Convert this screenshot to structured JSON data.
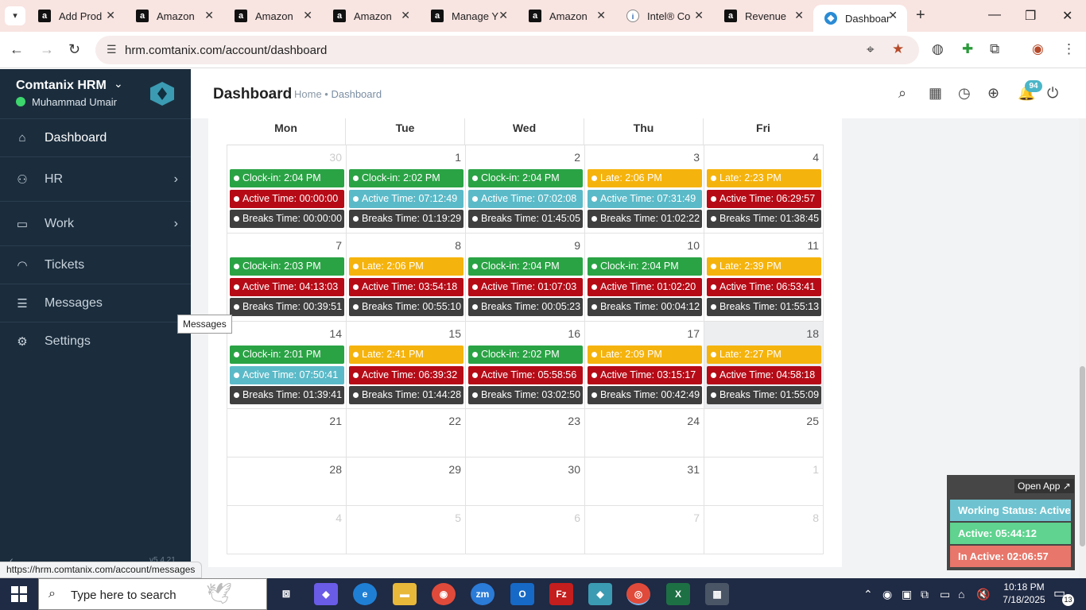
{
  "browser": {
    "tabs": [
      {
        "title": "Add Prod",
        "favicon": "amazon-a"
      },
      {
        "title": "Amazon",
        "favicon": "amazon-a"
      },
      {
        "title": "Amazon",
        "favicon": "amazon-a"
      },
      {
        "title": "Amazon",
        "favicon": "amazon-a"
      },
      {
        "title": "Manage Y",
        "favicon": "amazon-a"
      },
      {
        "title": "Amazon",
        "favicon": "amazon-a"
      },
      {
        "title": "Intel® Co",
        "favicon": "intel"
      },
      {
        "title": "Revenue",
        "favicon": "amazon-a"
      },
      {
        "title": "Dashboar",
        "favicon": "comtanix",
        "active": true
      }
    ],
    "url": "hrm.comtanix.com/account/dashboard",
    "status_url": "https://hrm.comtanix.com/account/messages"
  },
  "sidebar": {
    "brand": "Comtanix HRM",
    "user": "Muhammad Umair",
    "items": [
      {
        "label": "Dashboard",
        "icon": "home-icon",
        "active": true
      },
      {
        "label": "HR",
        "icon": "users-icon",
        "submenu": true
      },
      {
        "label": "Work",
        "icon": "briefcase-icon",
        "submenu": true
      },
      {
        "label": "Tickets",
        "icon": "headset-icon"
      },
      {
        "label": "Messages",
        "icon": "message-icon"
      },
      {
        "label": "Settings",
        "icon": "gear-icon"
      }
    ],
    "tooltip": "Messages",
    "version": "v5.4.21"
  },
  "header": {
    "title": "Dashboard",
    "breadcrumb_home": "Home",
    "breadcrumb_sep": " • ",
    "breadcrumb_current": "Dashboard",
    "notification_count": "94"
  },
  "calendar": {
    "days_of_week": [
      "Mon",
      "Tue",
      "Wed",
      "Thu",
      "Fri"
    ],
    "weeks": [
      [
        {
          "day": "30",
          "other": true,
          "events": [
            {
              "type": "green",
              "text": "Clock-in: 2:04 PM"
            },
            {
              "type": "red",
              "text": "Active Time: 00:00:00"
            },
            {
              "type": "dark",
              "text": "Breaks Time: 00:00:00"
            }
          ]
        },
        {
          "day": "1",
          "events": [
            {
              "type": "green",
              "text": "Clock-in: 2:02 PM"
            },
            {
              "type": "teal",
              "text": "Active Time: 07:12:49"
            },
            {
              "type": "dark",
              "text": "Breaks Time: 01:19:29"
            }
          ]
        },
        {
          "day": "2",
          "events": [
            {
              "type": "green",
              "text": "Clock-in: 2:04 PM"
            },
            {
              "type": "teal",
              "text": "Active Time: 07:02:08"
            },
            {
              "type": "dark",
              "text": "Breaks Time: 01:45:05"
            }
          ]
        },
        {
          "day": "3",
          "events": [
            {
              "type": "amber",
              "text": "Late: 2:06 PM"
            },
            {
              "type": "teal",
              "text": "Active Time: 07:31:49"
            },
            {
              "type": "dark",
              "text": "Breaks Time: 01:02:22"
            }
          ]
        },
        {
          "day": "4",
          "events": [
            {
              "type": "amber",
              "text": "Late: 2:23 PM"
            },
            {
              "type": "red",
              "text": "Active Time: 06:29:57"
            },
            {
              "type": "dark",
              "text": "Breaks Time: 01:38:45"
            }
          ]
        }
      ],
      [
        {
          "day": "7",
          "events": [
            {
              "type": "green",
              "text": "Clock-in: 2:03 PM"
            },
            {
              "type": "red",
              "text": "Active Time: 04:13:03"
            },
            {
              "type": "dark",
              "text": "Breaks Time: 00:39:51"
            }
          ]
        },
        {
          "day": "8",
          "events": [
            {
              "type": "amber",
              "text": "Late: 2:06 PM"
            },
            {
              "type": "red",
              "text": "Active Time: 03:54:18"
            },
            {
              "type": "dark",
              "text": "Breaks Time: 00:55:10"
            }
          ]
        },
        {
          "day": "9",
          "events": [
            {
              "type": "green",
              "text": "Clock-in: 2:04 PM"
            },
            {
              "type": "red",
              "text": "Active Time: 01:07:03"
            },
            {
              "type": "dark",
              "text": "Breaks Time: 00:05:23"
            }
          ]
        },
        {
          "day": "10",
          "events": [
            {
              "type": "green",
              "text": "Clock-in: 2:04 PM"
            },
            {
              "type": "red",
              "text": "Active Time: 01:02:20"
            },
            {
              "type": "dark",
              "text": "Breaks Time: 00:04:12"
            }
          ]
        },
        {
          "day": "11",
          "events": [
            {
              "type": "amber",
              "text": "Late: 2:39 PM"
            },
            {
              "type": "red",
              "text": "Active Time: 06:53:41"
            },
            {
              "type": "dark",
              "text": "Breaks Time: 01:55:13"
            }
          ]
        }
      ],
      [
        {
          "day": "14",
          "events": [
            {
              "type": "green",
              "text": "Clock-in: 2:01 PM"
            },
            {
              "type": "teal",
              "text": "Active Time: 07:50:41"
            },
            {
              "type": "dark",
              "text": "Breaks Time: 01:39:41"
            }
          ]
        },
        {
          "day": "15",
          "events": [
            {
              "type": "amber",
              "text": "Late: 2:41 PM"
            },
            {
              "type": "red",
              "text": "Active Time: 06:39:32"
            },
            {
              "type": "dark",
              "text": "Breaks Time: 01:44:28"
            }
          ]
        },
        {
          "day": "16",
          "events": [
            {
              "type": "green",
              "text": "Clock-in: 2:02 PM"
            },
            {
              "type": "red",
              "text": "Active Time: 05:58:56"
            },
            {
              "type": "dark",
              "text": "Breaks Time: 03:02:50"
            }
          ]
        },
        {
          "day": "17",
          "events": [
            {
              "type": "amber",
              "text": "Late: 2:09 PM"
            },
            {
              "type": "red",
              "text": "Active Time: 03:15:17"
            },
            {
              "type": "dark",
              "text": "Breaks Time: 00:42:49"
            }
          ]
        },
        {
          "day": "18",
          "today": true,
          "events": [
            {
              "type": "amber",
              "text": "Late: 2:27 PM"
            },
            {
              "type": "red",
              "text": "Active Time: 04:58:18"
            },
            {
              "type": "dark",
              "text": "Breaks Time: 01:55:09"
            }
          ]
        }
      ],
      [
        {
          "day": "21",
          "events": []
        },
        {
          "day": "22",
          "events": []
        },
        {
          "day": "23",
          "events": []
        },
        {
          "day": "24",
          "events": []
        },
        {
          "day": "25",
          "events": []
        }
      ],
      [
        {
          "day": "28",
          "events": []
        },
        {
          "day": "29",
          "events": []
        },
        {
          "day": "30",
          "events": []
        },
        {
          "day": "31",
          "events": []
        },
        {
          "day": "1",
          "other": true,
          "events": []
        }
      ],
      [
        {
          "day": "4",
          "other": true,
          "events": []
        },
        {
          "day": "5",
          "other": true,
          "events": []
        },
        {
          "day": "6",
          "other": true,
          "events": []
        },
        {
          "day": "7",
          "other": true,
          "events": []
        },
        {
          "day": "8",
          "other": true,
          "events": []
        }
      ]
    ]
  },
  "widget": {
    "open_app": "Open App ↗",
    "working_status": "Working Status: Active",
    "active": "Active: 05:44:12",
    "inactive": "In Active: 02:06:57"
  },
  "taskbar": {
    "search_placeholder": "Type here to search",
    "time": "10:18 PM",
    "date": "7/18/2025",
    "notification_count": "13"
  },
  "colors": {
    "sidebar_bg": "#1b2d3d",
    "clock_in": "#2aa345",
    "late": "#f5b30d",
    "active_low": "#b60b17",
    "active_ok": "#5bbac8",
    "breaks": "#3f3f3f",
    "status_active": "#6fc3d0",
    "status_green": "#5fd38f",
    "status_red": "#e8766a"
  }
}
